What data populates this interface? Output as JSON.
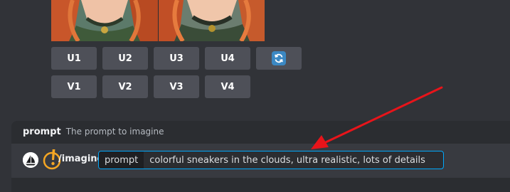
{
  "buttons": {
    "upscale": [
      "U1",
      "U2",
      "U3",
      "U4"
    ],
    "variation": [
      "V1",
      "V2",
      "V3",
      "V4"
    ],
    "reroll_icon": "refresh-icon"
  },
  "command_hint": {
    "name": "prompt",
    "description": "The prompt to imagine"
  },
  "input": {
    "command": "/imagine",
    "option_label": "prompt",
    "option_value": "colorful sneakers in the clouds, ultra realistic, lots of details"
  },
  "colors": {
    "background": "#313338",
    "button": "#4e5058",
    "focus_border": "#00a8fc",
    "annotation_arrow": "#e8141a",
    "annotation_marker": "#f5a623"
  }
}
